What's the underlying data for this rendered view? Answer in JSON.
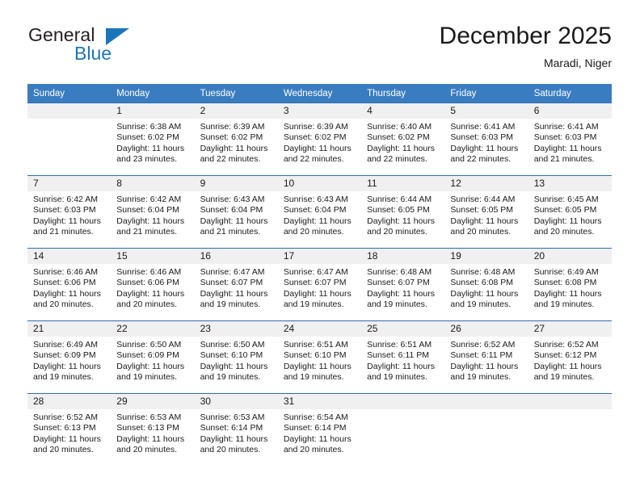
{
  "brand": {
    "name_part1": "General",
    "name_part2": "Blue",
    "logo_icon": "triangle-logo"
  },
  "header": {
    "title": "December 2025",
    "subtitle": "Maradi, Niger"
  },
  "calendar": {
    "weekday_headers": [
      "Sunday",
      "Monday",
      "Tuesday",
      "Wednesday",
      "Thursday",
      "Friday",
      "Saturday"
    ],
    "colors": {
      "header_background": "#3a7cc0",
      "row_divider": "#2c6eb5",
      "daynum_strip": "#f0f0f0",
      "brand_blue": "#1b75bb"
    },
    "labels": {
      "sunrise_prefix": "Sunrise:",
      "sunset_prefix": "Sunset:",
      "daylight_prefix": "Daylight:"
    },
    "weeks": [
      [
        {
          "day": "",
          "sunrise": "",
          "sunset": "",
          "daylight_line1": "",
          "daylight_line2": ""
        },
        {
          "day": "1",
          "sunrise": "Sunrise: 6:38 AM",
          "sunset": "Sunset: 6:02 PM",
          "daylight_line1": "Daylight: 11 hours",
          "daylight_line2": "and 23 minutes."
        },
        {
          "day": "2",
          "sunrise": "Sunrise: 6:39 AM",
          "sunset": "Sunset: 6:02 PM",
          "daylight_line1": "Daylight: 11 hours",
          "daylight_line2": "and 22 minutes."
        },
        {
          "day": "3",
          "sunrise": "Sunrise: 6:39 AM",
          "sunset": "Sunset: 6:02 PM",
          "daylight_line1": "Daylight: 11 hours",
          "daylight_line2": "and 22 minutes."
        },
        {
          "day": "4",
          "sunrise": "Sunrise: 6:40 AM",
          "sunset": "Sunset: 6:02 PM",
          "daylight_line1": "Daylight: 11 hours",
          "daylight_line2": "and 22 minutes."
        },
        {
          "day": "5",
          "sunrise": "Sunrise: 6:41 AM",
          "sunset": "Sunset: 6:03 PM",
          "daylight_line1": "Daylight: 11 hours",
          "daylight_line2": "and 22 minutes."
        },
        {
          "day": "6",
          "sunrise": "Sunrise: 6:41 AM",
          "sunset": "Sunset: 6:03 PM",
          "daylight_line1": "Daylight: 11 hours",
          "daylight_line2": "and 21 minutes."
        }
      ],
      [
        {
          "day": "7",
          "sunrise": "Sunrise: 6:42 AM",
          "sunset": "Sunset: 6:03 PM",
          "daylight_line1": "Daylight: 11 hours",
          "daylight_line2": "and 21 minutes."
        },
        {
          "day": "8",
          "sunrise": "Sunrise: 6:42 AM",
          "sunset": "Sunset: 6:04 PM",
          "daylight_line1": "Daylight: 11 hours",
          "daylight_line2": "and 21 minutes."
        },
        {
          "day": "9",
          "sunrise": "Sunrise: 6:43 AM",
          "sunset": "Sunset: 6:04 PM",
          "daylight_line1": "Daylight: 11 hours",
          "daylight_line2": "and 21 minutes."
        },
        {
          "day": "10",
          "sunrise": "Sunrise: 6:43 AM",
          "sunset": "Sunset: 6:04 PM",
          "daylight_line1": "Daylight: 11 hours",
          "daylight_line2": "and 20 minutes."
        },
        {
          "day": "11",
          "sunrise": "Sunrise: 6:44 AM",
          "sunset": "Sunset: 6:05 PM",
          "daylight_line1": "Daylight: 11 hours",
          "daylight_line2": "and 20 minutes."
        },
        {
          "day": "12",
          "sunrise": "Sunrise: 6:44 AM",
          "sunset": "Sunset: 6:05 PM",
          "daylight_line1": "Daylight: 11 hours",
          "daylight_line2": "and 20 minutes."
        },
        {
          "day": "13",
          "sunrise": "Sunrise: 6:45 AM",
          "sunset": "Sunset: 6:05 PM",
          "daylight_line1": "Daylight: 11 hours",
          "daylight_line2": "and 20 minutes."
        }
      ],
      [
        {
          "day": "14",
          "sunrise": "Sunrise: 6:46 AM",
          "sunset": "Sunset: 6:06 PM",
          "daylight_line1": "Daylight: 11 hours",
          "daylight_line2": "and 20 minutes."
        },
        {
          "day": "15",
          "sunrise": "Sunrise: 6:46 AM",
          "sunset": "Sunset: 6:06 PM",
          "daylight_line1": "Daylight: 11 hours",
          "daylight_line2": "and 20 minutes."
        },
        {
          "day": "16",
          "sunrise": "Sunrise: 6:47 AM",
          "sunset": "Sunset: 6:07 PM",
          "daylight_line1": "Daylight: 11 hours",
          "daylight_line2": "and 19 minutes."
        },
        {
          "day": "17",
          "sunrise": "Sunrise: 6:47 AM",
          "sunset": "Sunset: 6:07 PM",
          "daylight_line1": "Daylight: 11 hours",
          "daylight_line2": "and 19 minutes."
        },
        {
          "day": "18",
          "sunrise": "Sunrise: 6:48 AM",
          "sunset": "Sunset: 6:07 PM",
          "daylight_line1": "Daylight: 11 hours",
          "daylight_line2": "and 19 minutes."
        },
        {
          "day": "19",
          "sunrise": "Sunrise: 6:48 AM",
          "sunset": "Sunset: 6:08 PM",
          "daylight_line1": "Daylight: 11 hours",
          "daylight_line2": "and 19 minutes."
        },
        {
          "day": "20",
          "sunrise": "Sunrise: 6:49 AM",
          "sunset": "Sunset: 6:08 PM",
          "daylight_line1": "Daylight: 11 hours",
          "daylight_line2": "and 19 minutes."
        }
      ],
      [
        {
          "day": "21",
          "sunrise": "Sunrise: 6:49 AM",
          "sunset": "Sunset: 6:09 PM",
          "daylight_line1": "Daylight: 11 hours",
          "daylight_line2": "and 19 minutes."
        },
        {
          "day": "22",
          "sunrise": "Sunrise: 6:50 AM",
          "sunset": "Sunset: 6:09 PM",
          "daylight_line1": "Daylight: 11 hours",
          "daylight_line2": "and 19 minutes."
        },
        {
          "day": "23",
          "sunrise": "Sunrise: 6:50 AM",
          "sunset": "Sunset: 6:10 PM",
          "daylight_line1": "Daylight: 11 hours",
          "daylight_line2": "and 19 minutes."
        },
        {
          "day": "24",
          "sunrise": "Sunrise: 6:51 AM",
          "sunset": "Sunset: 6:10 PM",
          "daylight_line1": "Daylight: 11 hours",
          "daylight_line2": "and 19 minutes."
        },
        {
          "day": "25",
          "sunrise": "Sunrise: 6:51 AM",
          "sunset": "Sunset: 6:11 PM",
          "daylight_line1": "Daylight: 11 hours",
          "daylight_line2": "and 19 minutes."
        },
        {
          "day": "26",
          "sunrise": "Sunrise: 6:52 AM",
          "sunset": "Sunset: 6:11 PM",
          "daylight_line1": "Daylight: 11 hours",
          "daylight_line2": "and 19 minutes."
        },
        {
          "day": "27",
          "sunrise": "Sunrise: 6:52 AM",
          "sunset": "Sunset: 6:12 PM",
          "daylight_line1": "Daylight: 11 hours",
          "daylight_line2": "and 19 minutes."
        }
      ],
      [
        {
          "day": "28",
          "sunrise": "Sunrise: 6:52 AM",
          "sunset": "Sunset: 6:13 PM",
          "daylight_line1": "Daylight: 11 hours",
          "daylight_line2": "and 20 minutes."
        },
        {
          "day": "29",
          "sunrise": "Sunrise: 6:53 AM",
          "sunset": "Sunset: 6:13 PM",
          "daylight_line1": "Daylight: 11 hours",
          "daylight_line2": "and 20 minutes."
        },
        {
          "day": "30",
          "sunrise": "Sunrise: 6:53 AM",
          "sunset": "Sunset: 6:14 PM",
          "daylight_line1": "Daylight: 11 hours",
          "daylight_line2": "and 20 minutes."
        },
        {
          "day": "31",
          "sunrise": "Sunrise: 6:54 AM",
          "sunset": "Sunset: 6:14 PM",
          "daylight_line1": "Daylight: 11 hours",
          "daylight_line2": "and 20 minutes."
        },
        {
          "day": "",
          "sunrise": "",
          "sunset": "",
          "daylight_line1": "",
          "daylight_line2": ""
        },
        {
          "day": "",
          "sunrise": "",
          "sunset": "",
          "daylight_line1": "",
          "daylight_line2": ""
        },
        {
          "day": "",
          "sunrise": "",
          "sunset": "",
          "daylight_line1": "",
          "daylight_line2": ""
        }
      ]
    ]
  }
}
